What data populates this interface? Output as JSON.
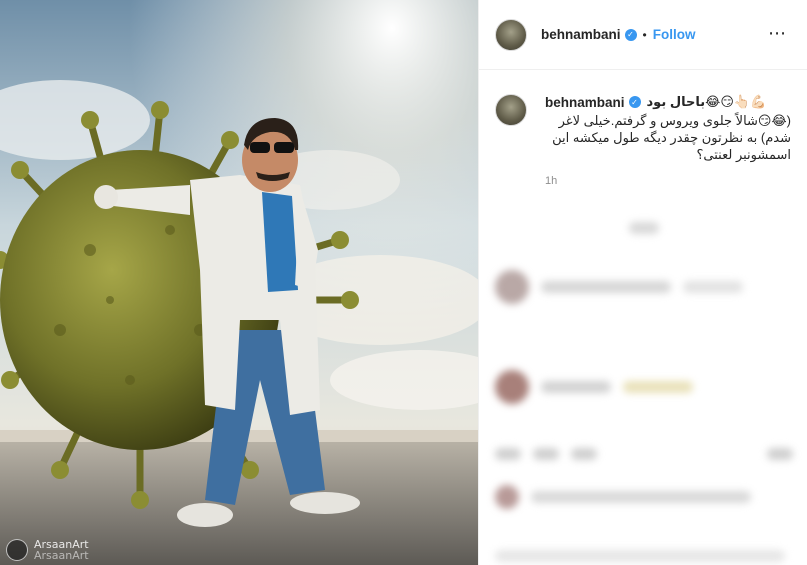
{
  "post": {
    "author": "behnambani",
    "follow_label": "Follow",
    "separator": "•",
    "more_icon": "⋯",
    "verified_mark": "✓",
    "caption_line1": "💪🏻👆🏻😏😂باحال بود",
    "caption_text": "(😂😏شالاً جلوی ویروس و گرفتم.خیلی لاغر شدم) به نظرتون چقدر دیگه طول میکشه این اسمشونبر لعنتی؟",
    "time_ago": "1h"
  },
  "media": {
    "watermark_handle": "ArsaanArt",
    "watermark_sub": "ArsaanArt"
  },
  "colors": {
    "accent": "#3897f0",
    "text": "#262626",
    "muted": "#8e8e8e"
  }
}
